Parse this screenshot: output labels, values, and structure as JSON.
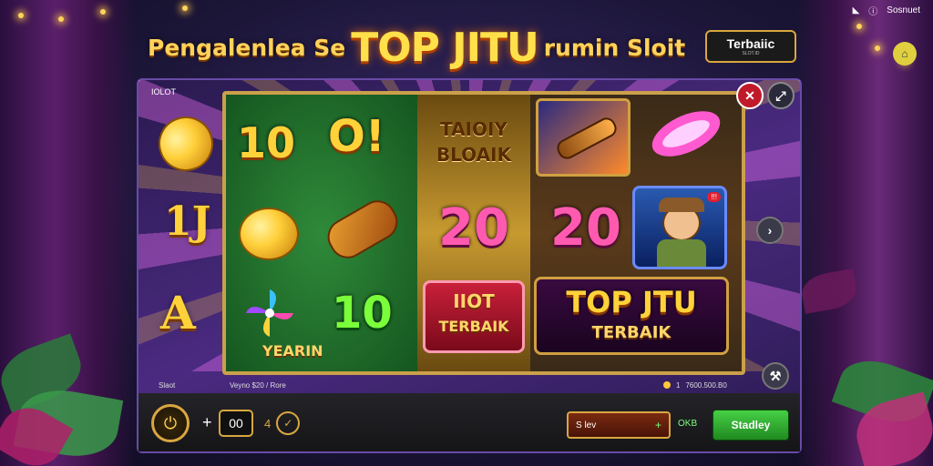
{
  "header": {
    "title_left": "Pengalenlea Se",
    "title_center": "TOP JITU",
    "title_right": "rumin Sloit",
    "badge_main": "Terbaiic",
    "badge_sub": "SLOT.ID"
  },
  "status_bar": {
    "icons": [
      "wifi-icon",
      "info-icon",
      "battery-icon"
    ],
    "label": "Sosnuet"
  },
  "game": {
    "frame_label": "IOLOT",
    "side_letters": [
      "1J",
      "A"
    ],
    "reels": {
      "reel1_top_numbers": [
        "10",
        "O!"
      ],
      "reel1_bottom_number": "10",
      "reel1_bottom_text": "YEARIN",
      "reel2_top_text_1": "TAIOIY",
      "reel2_top_text_2": "BLOAIK",
      "reel2_mid_number": "20",
      "reel2_tile_line1": "IIOT",
      "reel2_tile_line2": "TERBAIK",
      "reel3_mid_number": "20",
      "reel3_logo_line1": "TOP JTU",
      "reel3_logo_line2": "TERBAIK",
      "hero_badge": "!!!"
    }
  },
  "info_strip": {
    "left": "Slaot",
    "middle": "Veyno $20 / Rore",
    "right_count": "1",
    "right_value": "7600.500.B0"
  },
  "controls": {
    "power_icon": "power-icon",
    "plus": "+",
    "bet_value": "00",
    "auto_prefix": "4",
    "auto_icon": "check-icon",
    "lev_label": "S lev",
    "lev_plus": "+",
    "speed_label": "OKB",
    "start_label": "Stadley"
  },
  "colors": {
    "accent_gold": "#d9a640",
    "start_green": "#2fa82f",
    "close_red": "#c01a2a"
  }
}
